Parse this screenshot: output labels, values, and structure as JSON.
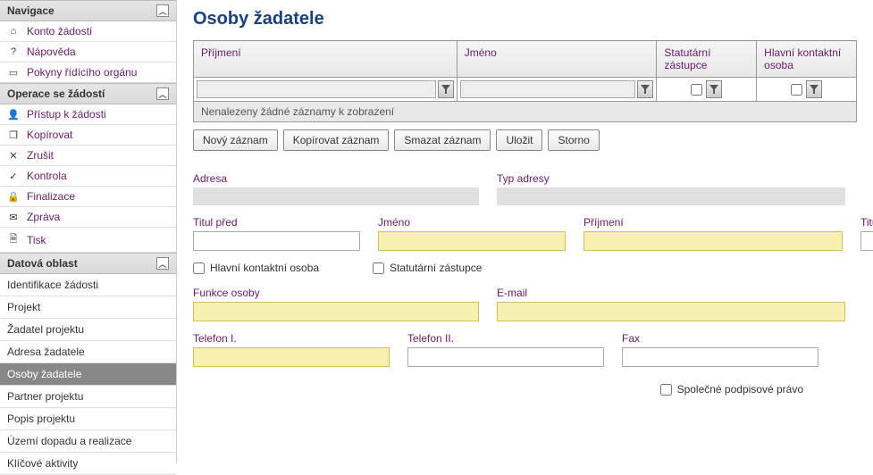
{
  "sidebar": {
    "nav_header": "Navigace",
    "nav_items": [
      {
        "icon": "⌂",
        "label": "Konto žádostí"
      },
      {
        "icon": "?",
        "label": "Nápověda"
      },
      {
        "icon": "▭",
        "label": "Pokyny řídícího orgánu"
      }
    ],
    "ops_header": "Operace se žádostí",
    "ops_items": [
      {
        "icon": "👤",
        "label": "Přístup k žádosti"
      },
      {
        "icon": "❐",
        "label": "Kopírovat"
      },
      {
        "icon": "✕",
        "label": "Zrušit"
      },
      {
        "icon": "✓",
        "label": "Kontrola"
      },
      {
        "icon": "🔒",
        "label": "Finalizace"
      },
      {
        "icon": "✉",
        "label": "Zpráva"
      },
      {
        "icon": "🗎",
        "label": "Tisk"
      }
    ],
    "data_header": "Datová oblast",
    "data_items": [
      "Identifikace žádosti",
      "Projekt",
      "Žadatel projektu",
      "Adresa žadatele",
      "Osoby žadatele",
      "Partner projektu",
      "Popis projektu",
      "Území dopadu a realizace",
      "Klíčové aktivity"
    ],
    "data_selected": 4
  },
  "page_title": "Osoby žadatele",
  "grid": {
    "cols": [
      "Příjmení",
      "Jméno",
      "Statutární zástupce",
      "Hlavní kontaktní osoba"
    ],
    "empty": "Nenalezeny žádné záznamy k zobrazení"
  },
  "buttons": {
    "new": "Nový záznam",
    "copy": "Kopírovat záznam",
    "delete": "Smazat záznam",
    "save": "Uložit",
    "cancel": "Storno"
  },
  "form": {
    "adresa": "Adresa",
    "typ_adresy": "Typ adresy",
    "titul_pred": "Titul před",
    "jmeno": "Jméno",
    "prijmeni": "Příjmení",
    "titul_za": "Titul za",
    "hlavni_kontakt": "Hlavní kontaktní osoba",
    "statutarni": "Statutární zástupce",
    "funkce": "Funkce osoby",
    "email": "E-mail",
    "tel1": "Telefon I.",
    "tel2": "Telefon II.",
    "fax": "Fax",
    "spolecne": "Společné podpisové právo"
  }
}
